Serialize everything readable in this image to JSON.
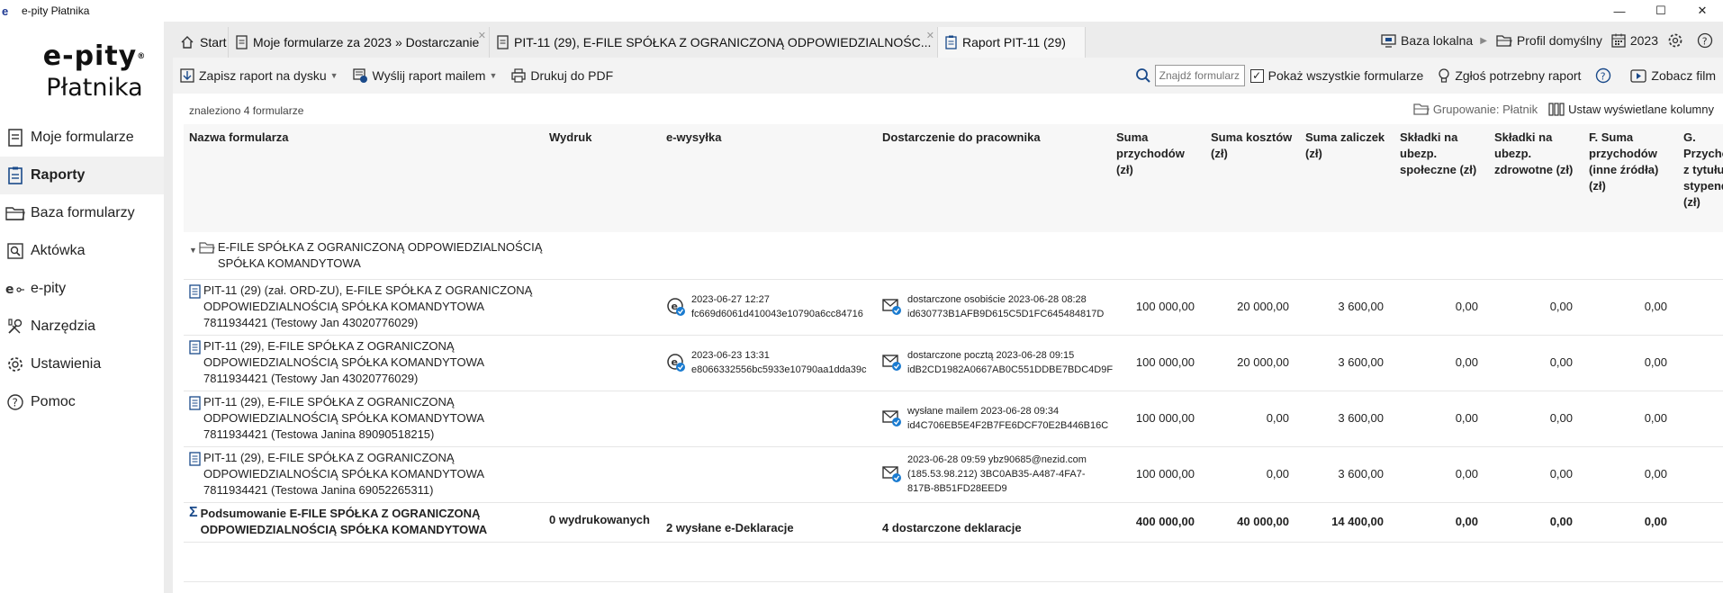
{
  "window": {
    "logo": "e",
    "title": "e-pity Płatnika",
    "minimize": "—",
    "maximize": "☐",
    "close": "✕"
  },
  "logo": {
    "top": "e-pity",
    "reg": "®",
    "bottom": "Płatnika"
  },
  "sidebar": {
    "items": [
      {
        "label": "Moje formularze",
        "icon": "form-icon"
      },
      {
        "label": "Raporty",
        "icon": "report-icon",
        "active": true
      },
      {
        "label": "Baza formularzy",
        "icon": "folder-icon"
      },
      {
        "label": "Aktówka",
        "icon": "briefcase-icon"
      },
      {
        "label": "e-pity",
        "icon": "epity-icon"
      },
      {
        "label": "Narzędzia",
        "icon": "tools-icon"
      },
      {
        "label": "Ustawienia",
        "icon": "gear-icon"
      },
      {
        "label": "Pomoc",
        "icon": "help-icon"
      }
    ]
  },
  "tabs": [
    {
      "label": "Start",
      "icon": "home-icon"
    },
    {
      "label": "Moje formularze za 2023 » Dostarczanie",
      "icon": "form-icon"
    },
    {
      "label": "PIT-11 (29), E-FILE SPÓŁKA Z OGRANICZONĄ ODPOWIEDZIALNOŚC...",
      "icon": "form-icon"
    },
    {
      "label": "Raport PIT-11 (29)",
      "icon": "report-icon",
      "active": true
    }
  ],
  "tab_close": "✕",
  "tabbar_right": {
    "local_db": "Baza lokalna",
    "arrow": "▶",
    "profile": "Profil domyślny",
    "year": "2023"
  },
  "toolbar": {
    "save": "Zapisz raport na dysku",
    "send": "Wyślij raport mailem",
    "print": "Drukuj do PDF",
    "dd": "▼",
    "search_placeholder": "Znajdź formularz",
    "check_mark": "✓",
    "show_all": "Pokaż wszystkie formularze",
    "request": "Zgłoś potrzebny raport",
    "help": "?",
    "film": "Zobacz film"
  },
  "content": {
    "found": "znaleziono 4 formularze",
    "grouping": "Grupowanie: Płatnik",
    "columns_setting": "Ustaw wyświetlane kolumny"
  },
  "table": {
    "headers": [
      "Nazwa formularza",
      "Wydruk",
      "e-wysyłka",
      "Dostarczenie do pracownika",
      "Suma przychodów (zł)",
      "Suma kosztów (zł)",
      "Suma zaliczek (zł)",
      "Składki na ubezp. społeczne (zł)",
      "Składki na ubezp. zdrowotne (zł)",
      "F. Suma przychodów (inne źródła) (zł)",
      "G. Przychody z tytułu stypendiów (zł)"
    ],
    "group": {
      "toggle": "▼",
      "name": "E-FILE SPÓŁKA Z OGRANICZONĄ ODPOWIEDZIALNOŚCIĄ SPÓŁKA KOMANDYTOWA"
    },
    "rows": [
      {
        "name": "PIT-11 (29) (zał. ORD-ZU), E-FILE SPÓŁKA Z OGRANICZONĄ ODPOWIEDZIALNOŚCIĄ SPÓŁKA KOMANDYTOWA 7811934421 (Testowy Jan 43020776029)",
        "wydruk": "",
        "ew_line1": "2023-06-27 12:27",
        "ew_line2": "fc669d6061d410043e10790a6cc84716",
        "dost_line1": "dostarczone osobiście 2023-06-28 08:28",
        "dost_line2": "id630773B1AFB9D615C5D1FC645484817D",
        "przychody": "100 000,00",
        "koszty": "20 000,00",
        "zaliczki": "3 600,00",
        "spoleczne": "0,00",
        "zdrowotne": "0,00",
        "inne": "0,00"
      },
      {
        "name": "PIT-11 (29), E-FILE SPÓŁKA Z OGRANICZONĄ ODPOWIEDZIALNOŚCIĄ SPÓŁKA KOMANDYTOWA 7811934421 (Testowy Jan 43020776029)",
        "wydruk": "",
        "ew_line1": "2023-06-23 13:31",
        "ew_line2": "e8066332556bc5933e10790aa1dda39c",
        "dost_line1": "dostarczone pocztą 2023-06-28 09:15",
        "dost_line2": "idB2CD1982A0667AB0C551DDBE7BDC4D9F",
        "przychody": "100 000,00",
        "koszty": "20 000,00",
        "zaliczki": "3 600,00",
        "spoleczne": "0,00",
        "zdrowotne": "0,00",
        "inne": "0,00"
      },
      {
        "name": "PIT-11 (29), E-FILE SPÓŁKA Z OGRANICZONĄ ODPOWIEDZIALNOŚCIĄ SPÓŁKA KOMANDYTOWA 7811934421 (Testowa Janina 89090518215)",
        "wydruk": "",
        "ew_line1": "",
        "ew_line2": "",
        "dost_line1": "wysłane mailem 2023-06-28 09:34",
        "dost_line2": "id4C706EB5E4F2B7FE6DCF70E2B446B16C",
        "przychody": "100 000,00",
        "koszty": "0,00",
        "zaliczki": "3 600,00",
        "spoleczne": "0,00",
        "zdrowotne": "0,00",
        "inne": "0,00"
      },
      {
        "name": "PIT-11 (29), E-FILE SPÓŁKA Z OGRANICZONĄ ODPOWIEDZIALNOŚCIĄ SPÓŁKA KOMANDYTOWA 7811934421 (Testowa Janina 69052265311)",
        "wydruk": "",
        "ew_line1": "",
        "ew_line2": "",
        "dost_line1": "2023-06-28 09:59 ybz90685@nezid.com (185.53.98.212) 3BC0AB35-A487-4FA7-817B-8B51FD28EED9",
        "dost_line2": "",
        "przychody": "100 000,00",
        "koszty": "0,00",
        "zaliczki": "3 600,00",
        "spoleczne": "0,00",
        "zdrowotne": "0,00",
        "inne": "0,00"
      }
    ],
    "summary": {
      "name": "Podsumowanie E-FILE SPÓŁKA Z OGRANICZONĄ ODPOWIEDZIALNOŚCIĄ SPÓŁKA KOMANDYTOWA",
      "wydruk": "0 wydrukowanych",
      "ewysylka": "2 wysłane e-Deklaracje",
      "dostarczenie": "4 dostarczone deklaracje",
      "przychody": "400 000,00",
      "koszty": "40 000,00",
      "zaliczki": "14 400,00",
      "spoleczne": "0,00",
      "zdrowotne": "0,00",
      "inne": "0,00"
    }
  }
}
